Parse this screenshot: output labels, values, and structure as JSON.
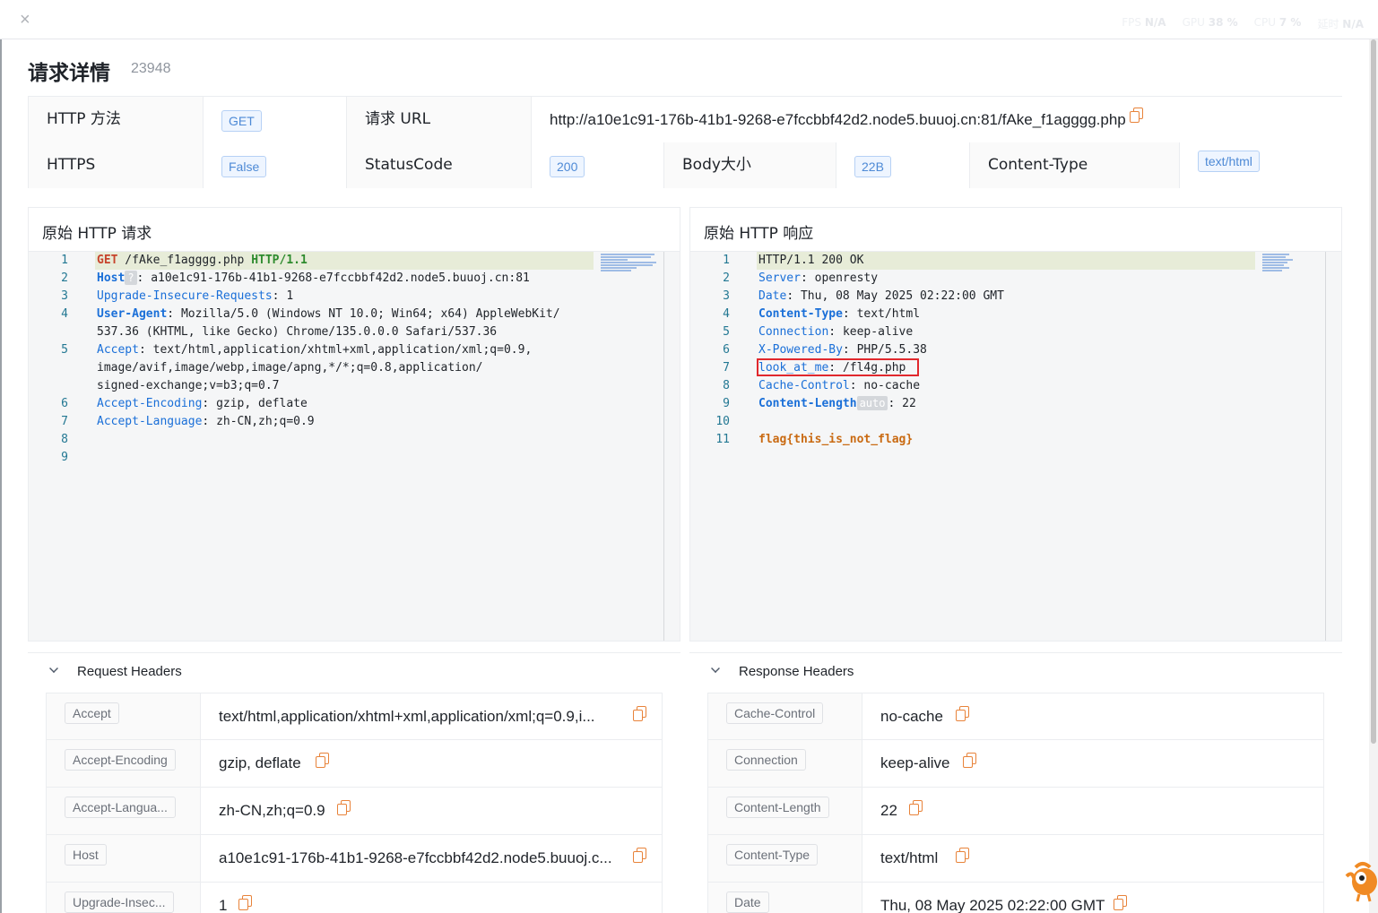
{
  "window": {
    "close_label": "×"
  },
  "perf": [
    {
      "label": "FPS",
      "value": "N/A"
    },
    {
      "label": "GPU",
      "value": "38 %"
    },
    {
      "label": "CPU",
      "value": "7 %"
    },
    {
      "label": "延时",
      "value": "N/A"
    }
  ],
  "page": {
    "title": "请求详情",
    "request_id": "23948"
  },
  "info": {
    "method_label": "HTTP 方法",
    "method": "GET",
    "url_label": "请求 URL",
    "url": "http://a10e1c91-176b-41b1-9268-e7fccbbf42d2.node5.buuoj.cn:81/fAke_f1agggg.php",
    "https_label": "HTTPS",
    "https": "False",
    "status_label": "StatusCode",
    "status": "200",
    "body_label": "Body大小",
    "body": "22B",
    "ctype_label": "Content-Type",
    "ctype": "text/html"
  },
  "raw_request": {
    "title": "原始 HTTP 请求",
    "lines": [
      {
        "n": "1",
        "method": "GET",
        "path": " /fAke_f1agggg.php ",
        "proto": "HTTP/1.1"
      },
      {
        "n": "2",
        "key": "Host",
        "badge": "?",
        "value": "a10e1c91-176b-41b1-9268-e7fccbbf42d2.node5.buuoj.cn:81"
      },
      {
        "n": "3",
        "key": "Upgrade-Insecure-Requests",
        "value": "1"
      },
      {
        "n": "4",
        "key": "User-Agent",
        "value": "Mozilla/5.0 (Windows NT 10.0; Win64; x64) AppleWebKit/",
        "cont": [
          "537.36 (KHTML, like Gecko) Chrome/135.0.0.0 Safari/537.36"
        ]
      },
      {
        "n": "5",
        "key": "Accept",
        "value": "text/html,application/xhtml+xml,application/xml;q=0.9,",
        "cont": [
          "image/avif,image/webp,image/apng,*/*;q=0.8,application/",
          "signed-exchange;v=b3;q=0.7"
        ]
      },
      {
        "n": "6",
        "key": "Accept-Encoding",
        "value": "gzip, deflate"
      },
      {
        "n": "7",
        "key": "Accept-Language",
        "value": "zh-CN,zh;q=0.9"
      },
      {
        "n": "8"
      },
      {
        "n": "9"
      }
    ]
  },
  "raw_response": {
    "title": "原始 HTTP 响应",
    "lines": [
      {
        "n": "1",
        "status": "HTTP/1.1 200 OK"
      },
      {
        "n": "2",
        "key": "Server",
        "value": "openresty"
      },
      {
        "n": "3",
        "key": "Date",
        "value": "Thu, 08 May 2025 02:22:00 GMT"
      },
      {
        "n": "4",
        "key": "Content-Type",
        "value": "text/html",
        "bold": true
      },
      {
        "n": "5",
        "key": "Connection",
        "value": "keep-alive"
      },
      {
        "n": "6",
        "key": "X-Powered-By",
        "value": "PHP/5.5.38"
      },
      {
        "n": "7",
        "key": "look_at_me",
        "value": "/fl4g.php"
      },
      {
        "n": "8",
        "key": "Cache-Control",
        "value": "no-cache"
      },
      {
        "n": "9",
        "key": "Content-Length",
        "badge": "auto",
        "value": "22",
        "bold": true
      },
      {
        "n": "10"
      },
      {
        "n": "11",
        "body": "flag{this_is_not_flag}"
      }
    ]
  },
  "request_headers": {
    "title": "Request Headers",
    "rows": [
      {
        "key": "Accept",
        "value": "text/html,application/xhtml+xml,application/xml;q=0.9,i..."
      },
      {
        "key": "Accept-Encoding",
        "value": "gzip, deflate"
      },
      {
        "key": "Accept-Langua...",
        "value": "zh-CN,zh;q=0.9"
      },
      {
        "key": "Host",
        "value": "a10e1c91-176b-41b1-9268-e7fccbbf42d2.node5.buuoj.c..."
      },
      {
        "key": "Upgrade-Insec...",
        "value": "1"
      }
    ]
  },
  "response_headers": {
    "title": "Response Headers",
    "rows": [
      {
        "key": "Cache-Control",
        "value": "no-cache"
      },
      {
        "key": "Connection",
        "value": "keep-alive"
      },
      {
        "key": "Content-Length",
        "value": "22"
      },
      {
        "key": "Content-Type",
        "value": "text/html"
      },
      {
        "key": "Date",
        "value": "Thu, 08 May 2025 02:22:00 GMT"
      }
    ]
  },
  "colors": {
    "accent": "#4e8ad6",
    "copy": "#e8833a",
    "highlight_box": "#e1282d"
  }
}
